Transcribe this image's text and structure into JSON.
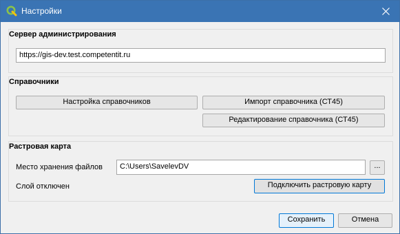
{
  "window": {
    "title": "Настройки",
    "app_icon": "qgis-icon",
    "close_icon": "close-icon"
  },
  "admin_server": {
    "section_title": "Сервер администрирования",
    "url_value": "https://gis-dev.test.competentit.ru"
  },
  "references": {
    "section_title": "Справочники",
    "settings_button": "Настройка справочников",
    "import_button": "Импорт справочника (СТ45)",
    "edit_button": "Редактирование справочника (СТ45)"
  },
  "raster_map": {
    "section_title": "Растровая карта",
    "storage_label": "Место хранения файлов",
    "storage_path": "C:\\Users\\SavelevDV",
    "browse_button": "...",
    "layer_status": "Слой отключен",
    "connect_button": "Подключить растровую карту"
  },
  "footer": {
    "save_button": "Сохранить",
    "cancel_button": "Отмена"
  },
  "colors": {
    "titlebar": "#3a74b4",
    "window_bg": "#f0f0f0",
    "accent_border": "#0078d7"
  }
}
